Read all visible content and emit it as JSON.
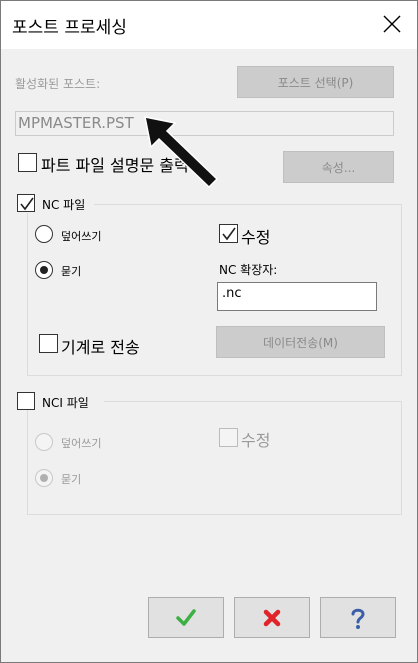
{
  "window": {
    "title": "포스트 프로세싱"
  },
  "active_post": {
    "label": "활성화된 포스트:",
    "select_button": "포스트 선택(P)",
    "value": "MPMASTER.PST"
  },
  "part_file": {
    "label": "파트 파일 설명문 출력",
    "properties_button": "속성..."
  },
  "nc_file": {
    "label": "NC 파일",
    "checked": true,
    "overwrite_label": "덮어쓰기",
    "ask_label": "묻기",
    "edit_label": "수정",
    "edit_checked": true,
    "extension_label": "NC 확장자:",
    "extension_value": ".nc",
    "send_to_machine_label": "기계로 전송",
    "data_transfer_button": "데이터전송(M)"
  },
  "nci_file": {
    "label": "NCI 파일",
    "checked": false,
    "overwrite_label": "덮어쓰기",
    "ask_label": "묻기",
    "edit_label": "수정"
  },
  "icons": {
    "ok": "checkmark-icon",
    "cancel": "x-icon",
    "help": "question-icon",
    "close": "close-icon",
    "pointer": "arrow-annotation"
  },
  "colors": {
    "ok_green": "#3cb043",
    "cancel_red": "#e0242a",
    "help_blue": "#3a5fa8"
  }
}
